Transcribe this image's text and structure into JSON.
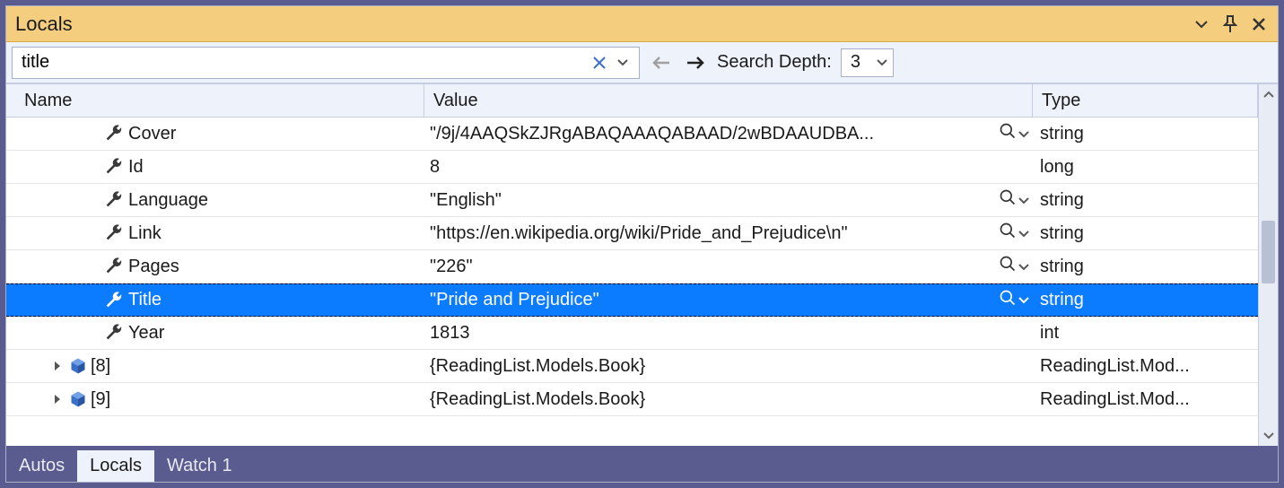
{
  "titlebar": {
    "title": "Locals"
  },
  "toolbar": {
    "search_value": "title",
    "depth_label": "Search Depth:",
    "depth_value": "3"
  },
  "columns": {
    "name": "Name",
    "value": "Value",
    "type": "Type"
  },
  "rows": [
    {
      "kind": "prop",
      "name": "Cover",
      "value": "\"/9j/4AAQSkZJRgABAQAAAQABAAD/2wBDAAUDBA...",
      "type": "string",
      "viz": true,
      "selected": false
    },
    {
      "kind": "prop",
      "name": "Id",
      "value": "8",
      "type": "long",
      "viz": false,
      "selected": false
    },
    {
      "kind": "prop",
      "name": "Language",
      "value": "\"English\"",
      "type": "string",
      "viz": true,
      "selected": false
    },
    {
      "kind": "prop",
      "name": "Link",
      "value": "\"https://en.wikipedia.org/wiki/Pride_and_Prejudice\\n\"",
      "type": "string",
      "viz": true,
      "selected": false
    },
    {
      "kind": "prop",
      "name": "Pages",
      "value": "\"226\"",
      "type": "string",
      "viz": true,
      "selected": false
    },
    {
      "kind": "prop",
      "name": "Title",
      "value": "\"Pride and Prejudice\"",
      "type": "string",
      "viz": true,
      "selected": true
    },
    {
      "kind": "prop",
      "name": "Year",
      "value": "1813",
      "type": "int",
      "viz": false,
      "selected": false
    },
    {
      "kind": "obj",
      "name": "[8]",
      "value": "{ReadingList.Models.Book}",
      "type": "ReadingList.Mod...",
      "viz": false,
      "selected": false
    },
    {
      "kind": "obj",
      "name": "[9]",
      "value": "{ReadingList.Models.Book}",
      "type": "ReadingList.Mod...",
      "viz": false,
      "selected": false
    }
  ],
  "tabs": [
    {
      "label": "Autos",
      "active": false
    },
    {
      "label": "Locals",
      "active": true
    },
    {
      "label": "Watch 1",
      "active": false
    }
  ]
}
